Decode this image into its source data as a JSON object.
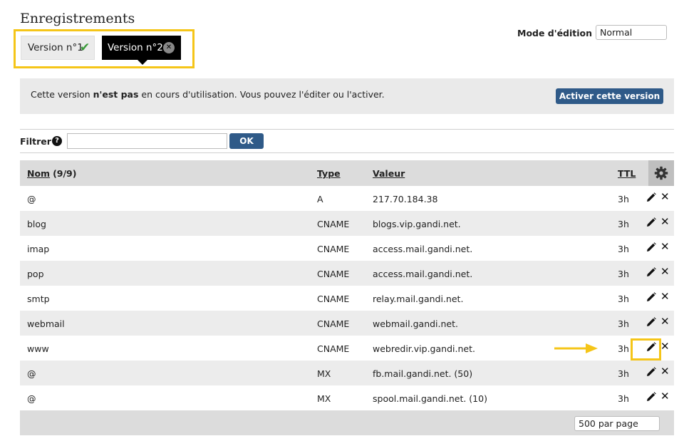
{
  "page": {
    "title": "Enregistrements"
  },
  "versions": {
    "tab1_label": "Version n°1",
    "tab2_label": "Version n°2"
  },
  "mode": {
    "label": "Mode d'édition",
    "value": "Normal"
  },
  "info": {
    "text_before": "Cette version ",
    "text_bold": "n'est pas",
    "text_after": " en cours d'utilisation. Vous pouvez l'éditer ou l'activer.",
    "activate_label": "Activer cette version"
  },
  "filter": {
    "label": "Filtrer",
    "value": "",
    "ok_label": "OK"
  },
  "table": {
    "headers": {
      "name": "Nom",
      "count": "(9/9)",
      "type": "Type",
      "value": "Valeur",
      "ttl": "TTL"
    },
    "rows": [
      {
        "name": "@",
        "type": "A",
        "value": "217.70.184.38",
        "ttl": "3h"
      },
      {
        "name": "blog",
        "type": "CNAME",
        "value": "blogs.vip.gandi.net.",
        "ttl": "3h"
      },
      {
        "name": "imap",
        "type": "CNAME",
        "value": "access.mail.gandi.net.",
        "ttl": "3h"
      },
      {
        "name": "pop",
        "type": "CNAME",
        "value": "access.mail.gandi.net.",
        "ttl": "3h"
      },
      {
        "name": "smtp",
        "type": "CNAME",
        "value": "relay.mail.gandi.net.",
        "ttl": "3h"
      },
      {
        "name": "webmail",
        "type": "CNAME",
        "value": "webmail.gandi.net.",
        "ttl": "3h"
      },
      {
        "name": "www",
        "type": "CNAME",
        "value": "webredir.vip.gandi.net.",
        "ttl": "3h"
      },
      {
        "name": "@",
        "type": "MX",
        "value": "fb.mail.gandi.net. (50)",
        "ttl": "3h"
      },
      {
        "name": "@",
        "type": "MX",
        "value": "spool.mail.gandi.net. (10)",
        "ttl": "3h"
      }
    ],
    "per_page": "500 par page"
  },
  "icons": {
    "check": "check-icon",
    "close": "close-circle-icon",
    "help": "help-icon",
    "gear": "gear-icon",
    "edit": "pencil-icon",
    "delete": "x-icon",
    "arrow": "arrow-right-icon"
  },
  "colors": {
    "highlight": "#f5c518",
    "button": "#2f5a88",
    "check": "#3a9a3a",
    "active_tab": "#000000"
  }
}
